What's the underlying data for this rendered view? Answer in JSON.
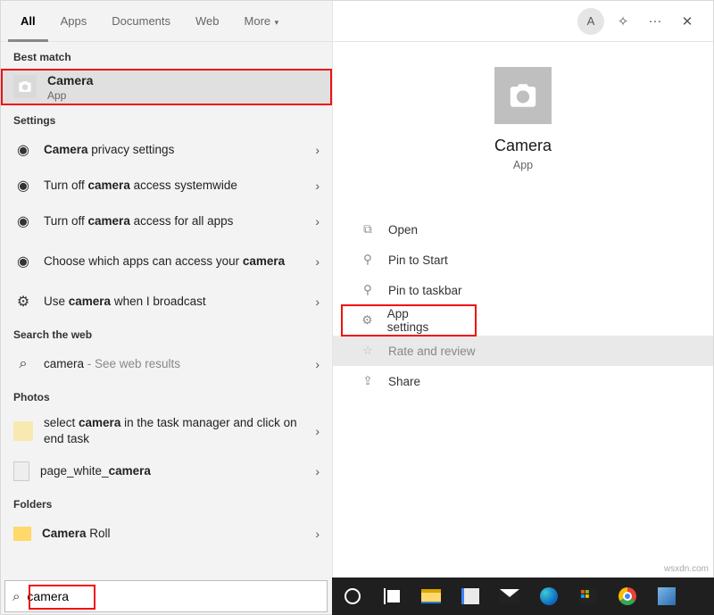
{
  "tabs": {
    "all": "All",
    "apps": "Apps",
    "documents": "Documents",
    "web": "Web",
    "more": "More"
  },
  "top": {
    "avatar": "A",
    "more": "···",
    "close": "✕"
  },
  "sections": {
    "best_match": "Best match",
    "settings": "Settings",
    "search_web": "Search the web",
    "photos": "Photos",
    "folders": "Folders"
  },
  "best": {
    "title": "Camera",
    "subtitle": "App"
  },
  "settings_items": {
    "privacy": "<b>Camera</b> privacy settings",
    "off_system": "Turn off <b>camera</b> access systemwide",
    "off_apps": "Turn off <b>camera</b> access for all apps",
    "choose": "Choose which apps can access your <b>camera</b>",
    "broadcast": "Use <b>camera</b> when I broadcast"
  },
  "web_item": {
    "prefix": "camera",
    "suffix": " - See web results"
  },
  "photos_items": {
    "taskmgr": "select <b>camera</b> in the task manager and click on end task",
    "pagewhite": "page_white_<b>camera</b>"
  },
  "folders_items": {
    "roll": "<b>Camera</b> Roll"
  },
  "preview": {
    "title": "Camera",
    "subtitle": "App"
  },
  "actions": {
    "open": "Open",
    "pin_start": "Pin to Start",
    "pin_taskbar": "Pin to taskbar",
    "app_settings": "App settings",
    "rate": "Rate and review",
    "share": "Share"
  },
  "search": {
    "value": "camera"
  },
  "watermark": "wsxdn.com"
}
